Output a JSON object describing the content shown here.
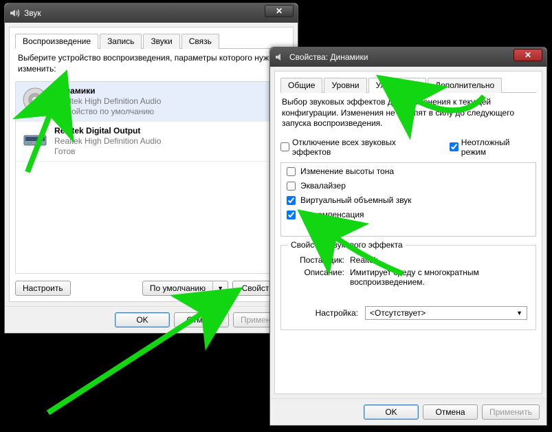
{
  "sound_window": {
    "title": "Звук",
    "tabs": {
      "playback": "Воспроизведение",
      "recording": "Запись",
      "sounds": "Звуки",
      "communications": "Связь"
    },
    "instruction": "Выберите устройство воспроизведения, параметры которого нужно изменить:",
    "devices": [
      {
        "name": "Динамики",
        "sub1": "Realtek High Definition Audio",
        "sub2": "Устройство по умолчанию",
        "type": "speaker",
        "default": true
      },
      {
        "name": "Realtek Digital Output",
        "sub1": "Realtek High Definition Audio",
        "sub2": "Готов",
        "type": "digital",
        "default": false
      }
    ],
    "buttons": {
      "configure": "Настроить",
      "default": "По умолчанию",
      "properties": "Свойства",
      "ok": "OK",
      "cancel": "Отмена",
      "apply": "Применить"
    }
  },
  "props_window": {
    "title": "Свойства: Динамики",
    "tabs": {
      "general": "Общие",
      "levels": "Уровни",
      "enhancements": "Улучшения",
      "advanced": "Дополнительно"
    },
    "desc": "Выбор звуковых эффектов для применения к текущей конфигурации. Изменения не вступят в силу до следующего запуска воспроизведения.",
    "check_disable_all": "Отключение всех звуковых эффектов",
    "check_immediate": "Неотложный режим",
    "effects": [
      {
        "label": "Изменение высоты тона",
        "checked": false
      },
      {
        "label": "Эквалайзер",
        "checked": false
      },
      {
        "label": "Виртуальный объемный звук",
        "checked": true
      },
      {
        "label": "Тонкомпенсация",
        "checked": true
      }
    ],
    "effect_group": {
      "legend": "Свойства звукового эффекта",
      "vendor_label": "Поставщик:",
      "vendor_value": "Realtek",
      "desc_label": "Описание:",
      "desc_value": "Имитирует среду с многократным воспроизведением."
    },
    "setting_label": "Настройка:",
    "setting_value": "<Отсутствует>",
    "buttons": {
      "ok": "OK",
      "cancel": "Отмена",
      "apply": "Применить"
    }
  }
}
